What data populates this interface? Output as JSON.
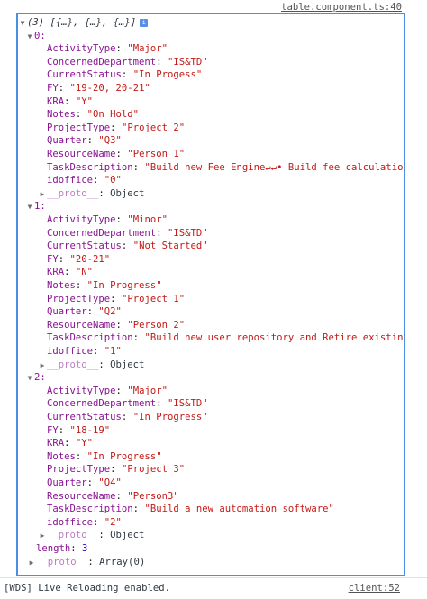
{
  "header": {
    "source_link": "table.component.ts:40"
  },
  "array": {
    "summary": "(3) [{…}, {…}, {…}]",
    "info_icon": "info-icon",
    "items": [
      {
        "index": "0:",
        "fields": [
          {
            "key": "ActivityType",
            "value": "\"Major\""
          },
          {
            "key": "ConcernedDepartment",
            "value": "\"IS&TD\""
          },
          {
            "key": "CurrentStatus",
            "value": "\"In Progess\""
          },
          {
            "key": "FY",
            "value": "\"19-20, 20-21\""
          },
          {
            "key": "KRA",
            "value": "\"Y\""
          },
          {
            "key": "Notes",
            "value": "\"On Hold\""
          },
          {
            "key": "ProjectType",
            "value": "\"Project 2\""
          },
          {
            "key": "Quarter",
            "value": "\"Q3\""
          },
          {
            "key": "ResourceName",
            "value": "\"Person 1\""
          },
          {
            "key": "TaskDescription",
            "value": "\"Build new Fee Engine↵↵• Build fee calculation…"
          },
          {
            "key": "idoffice",
            "value": "\"0\""
          }
        ],
        "proto_key": "__proto__",
        "proto_value": "Object"
      },
      {
        "index": "1:",
        "fields": [
          {
            "key": "ActivityType",
            "value": "\"Minor\""
          },
          {
            "key": "ConcernedDepartment",
            "value": "\"IS&TD\""
          },
          {
            "key": "CurrentStatus",
            "value": "\"Not Started\""
          },
          {
            "key": "FY",
            "value": "\"20-21\""
          },
          {
            "key": "KRA",
            "value": "\"N\""
          },
          {
            "key": "Notes",
            "value": "\"In Progress\""
          },
          {
            "key": "ProjectType",
            "value": "\"Project 1\""
          },
          {
            "key": "Quarter",
            "value": "\"Q2\""
          },
          {
            "key": "ResourceName",
            "value": "\"Person 2\""
          },
          {
            "key": "TaskDescription",
            "value": "\"Build new user repository and Retire existing…"
          },
          {
            "key": "idoffice",
            "value": "\"1\""
          }
        ],
        "proto_key": "__proto__",
        "proto_value": "Object"
      },
      {
        "index": "2:",
        "fields": [
          {
            "key": "ActivityType",
            "value": "\"Major\""
          },
          {
            "key": "ConcernedDepartment",
            "value": "\"IS&TD\""
          },
          {
            "key": "CurrentStatus",
            "value": "\"In Progress\""
          },
          {
            "key": "FY",
            "value": "\"18-19\""
          },
          {
            "key": "KRA",
            "value": "\"Y\""
          },
          {
            "key": "Notes",
            "value": "\"In Progress\""
          },
          {
            "key": "ProjectType",
            "value": "\"Project 3\""
          },
          {
            "key": "Quarter",
            "value": "\"Q4\""
          },
          {
            "key": "ResourceName",
            "value": "\"Person3\""
          },
          {
            "key": "TaskDescription",
            "value": "\"Build a new automation software\""
          },
          {
            "key": "idoffice",
            "value": "\"2\""
          }
        ],
        "proto_key": "__proto__",
        "proto_value": "Object"
      }
    ],
    "length_key": "length",
    "length_value": "3",
    "proto_key": "__proto__",
    "proto_value": "Array(0)"
  },
  "footer": {
    "message": "[WDS] Live Reloading enabled.",
    "source_link": "client:52"
  }
}
